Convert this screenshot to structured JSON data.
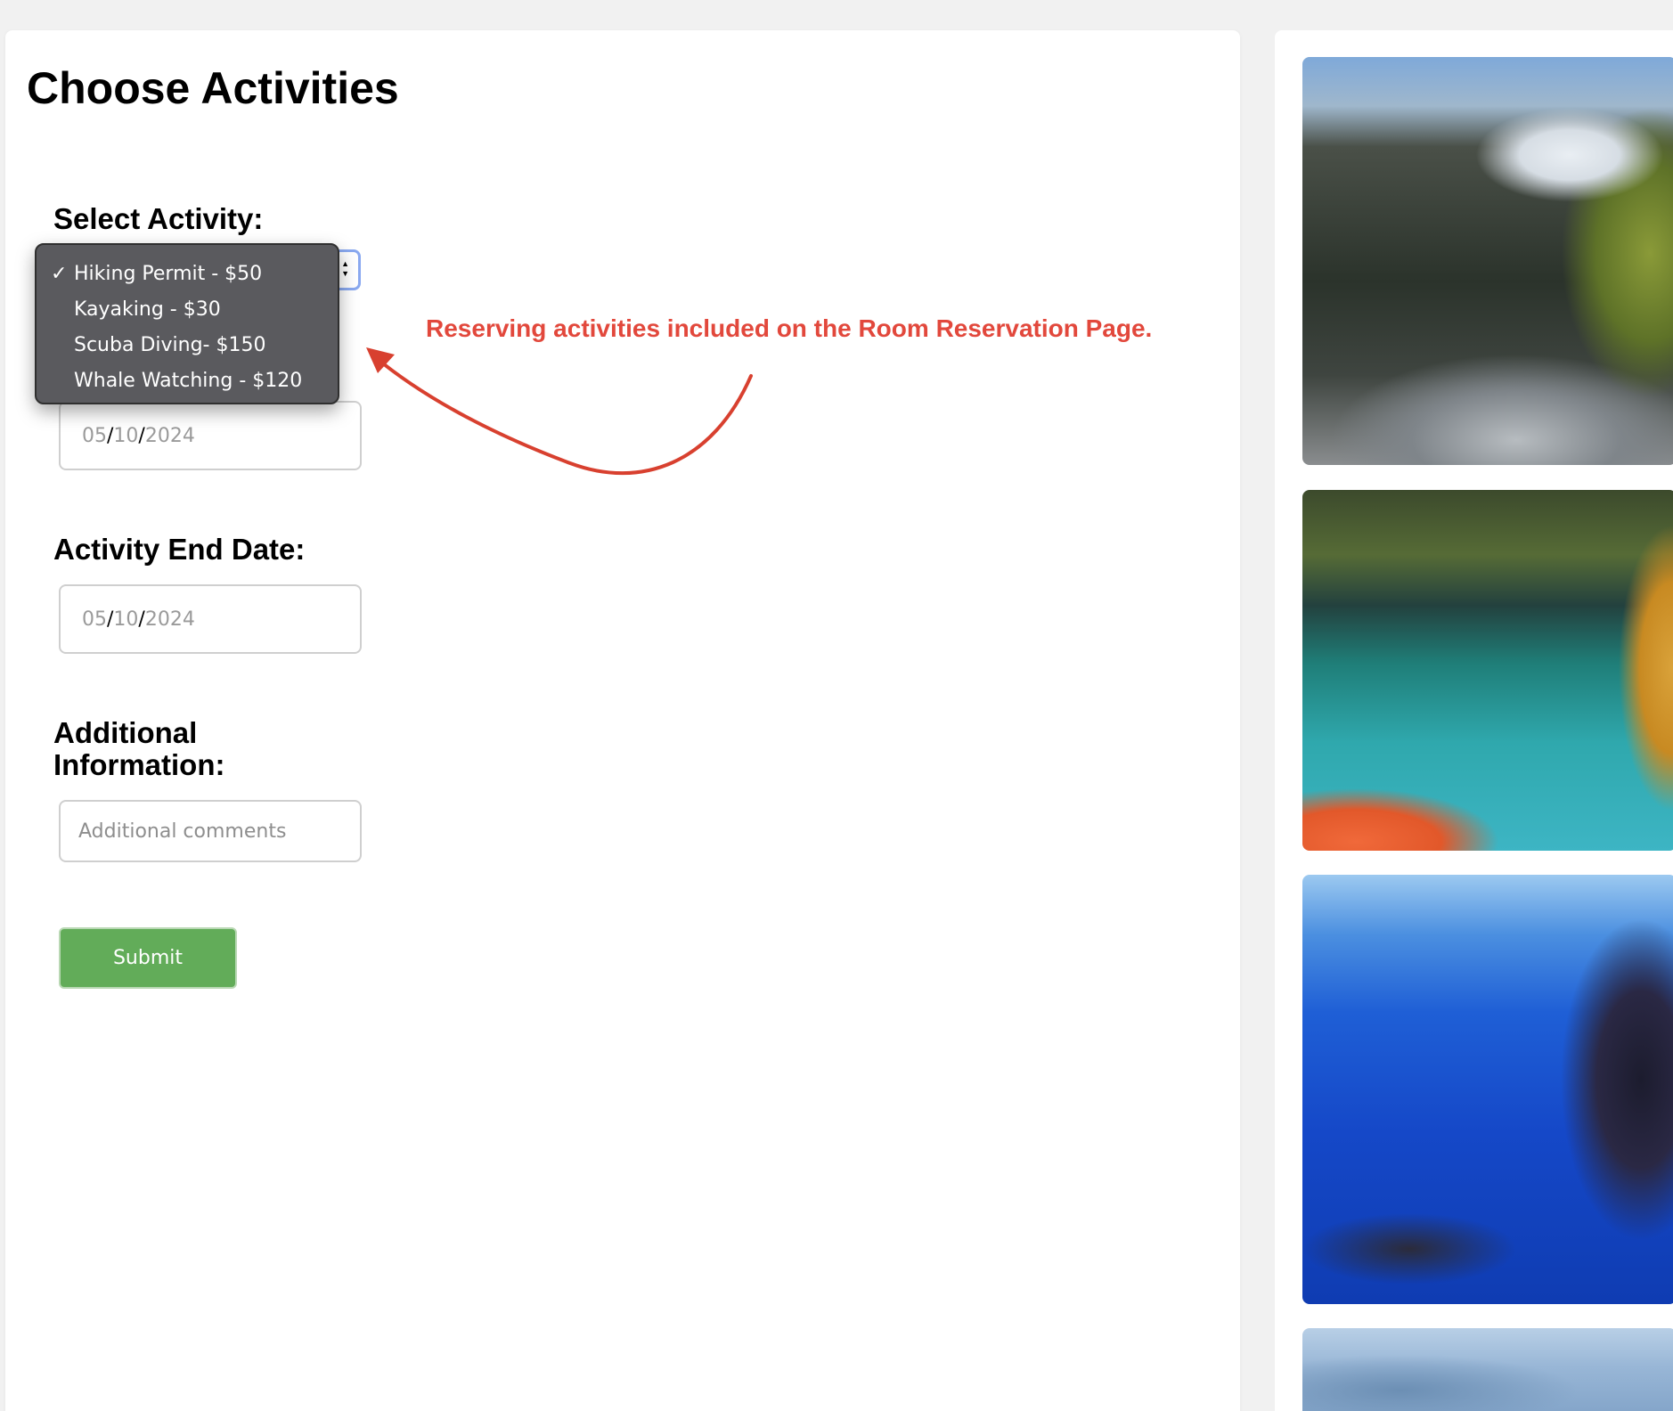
{
  "page": {
    "title": "Choose Activities"
  },
  "form": {
    "select_activity_label": "Select Activity:",
    "activity_options": [
      "Hiking Permit - $50",
      "Kayaking - $30",
      "Scuba Diving- $150",
      "Whale Watching - $120"
    ],
    "selected_option": "Hiking Permit - $50",
    "start_date": {
      "month": "05",
      "day": "10",
      "year": "2024"
    },
    "end_date_label": "Activity End Date:",
    "end_date": {
      "month": "05",
      "day": "10",
      "year": "2024"
    },
    "additional_info_label_line1": "Additional",
    "additional_info_label_line2": "Information:",
    "comments_placeholder": "Additional comments",
    "submit_label": "Submit"
  },
  "annotation": {
    "text": "Reserving activities included on the Room Reservation Page.",
    "color": "#e2483c"
  },
  "icons": {
    "check": "✓",
    "select_arrows_up": "▲",
    "select_arrows_down": "▼"
  },
  "colors": {
    "submit_button": "#62ac59",
    "dropdown_background": "#5a5a5e",
    "select_focus_ring": "#8aa9f0"
  }
}
